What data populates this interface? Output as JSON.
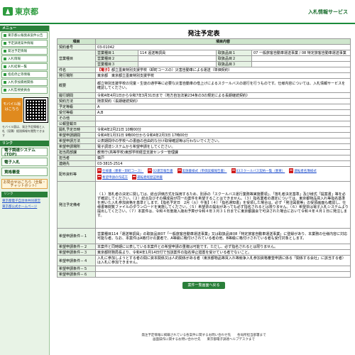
{
  "header": {
    "logo_text": "東京都",
    "site_title": "入札情報サービス"
  },
  "sidebar": {
    "menu_heading": "メニュー",
    "menu_items": [
      "東京都公報発表案件公告",
      "予定調達案件情報",
      "発注予定情報",
      "入札情報",
      "入札結果一覧",
      "指名停止等情報",
      "入札参加資格関係",
      "入札監視委員会"
    ],
    "mobile_label": "モバイル版はこちら",
    "mobile_note": "モバイル版は、発注予定情報と入札（見積）経過情報を閲覧できます",
    "related_heading": "リンク",
    "big_items": [
      "電子調達システム(TOP)",
      "電子入札",
      "資格審査"
    ],
    "faq_label": "お問合せはこちら（全般・チャットボット）",
    "links_heading": "リンク",
    "ext_links": [
      "東京都電子自治体共同運営",
      "東京都公式ホームページ"
    ]
  },
  "main": {
    "page_title": "発注予定表",
    "col_item": "項目",
    "col_content": "項目内容",
    "rows": {
      "contract_no_label": "契約番号",
      "contract_no": "03-01042",
      "category_label": "営業種目",
      "cat1_label": "営業種目１",
      "cat1": "114 遠送等調員",
      "cat2_label": "営業種目２",
      "cat3_label": "営業種目３",
      "handle1_label": "取扱品目１",
      "handle1": "07 一般旅客自動車運送事業 / 08 特定旅客自動車運送事業",
      "handle2_label": "取扱品目２",
      "handle3_label": "取扱品目３",
      "subject_label": "件名",
      "subject_tag": "【電子】",
      "subject": "都立墨東特別支援学校（卸町コースの）災害自動車による運送（単価契約）",
      "agency_label": "発行場所",
      "agency": "東京都　東京都立墨東特別支援学校",
      "overview_label": "概要",
      "overview": "都立特別支援学校の児童・生徒の通学等に必要な災害自動車の借上げによるスクールバスの運行を行うものです。仕様内容については、入札情報サービスを確認してください。",
      "period_label": "履行期間",
      "period": "令和4年4月1日から令和7年3月31日まで（地方自治法第234条の3の規定による長期継続契約）",
      "method_label": "契約方法",
      "method": "随意契約（長期継続契約）",
      "tender_label": "予定等級",
      "tender": "A",
      "grade_label": "受付等級",
      "grade": "A,B",
      "other_label": "その他",
      "notice_date_label": "公報登載日",
      "notice_date": "",
      "open_date_label": "開札予定日時",
      "open_date": "令和4年2月21日 10時00分",
      "apply_period_label": "希望申請期間",
      "apply_period": "令和4年1月31日 9時00分から令和4年2月3日 17時00分",
      "apply_place_label": "希望申請方法",
      "apply_place": "公表期間中の学校への書面の自由的な分け取得確認等は行わないでください。",
      "apply_tel_label": "希望申請場所",
      "apply_tel": "電子調達システムから希望申請をしてください。",
      "dept_label": "担当局部課",
      "dept": "教育庁(高等学校)東部学校経営支援センター管理課",
      "person_label": "担当者",
      "person": "槙戸",
      "contact_label": "連絡先",
      "contact": "03-3815-2514",
      "docs_label": "配布資料等",
      "docs": [
        "仕様書（墨東・卸町コース）",
        "02運営報告書",
        "実施書様式（単価実績報告書）",
        "03スクールバス契約一覧（墨東）",
        "運転者名簿様式",
        "希望申請の作成方",
        "運転者経歴証明書"
      ],
      "terms_label": "発注予定備考",
      "terms": "（１）落札者の決定に関しては、総合評価方式を採用するため、別添の「スクールバス運行業務等実施要領」、「落札者決定基準」及び様式「提案書」等を必ず確認してください。（２）総合及びその構成員が同一の案件を希望することはできません。（３）指名業者の選定については、東京都物品買入れ等指名基準を用いた入札参加資格を基準とします。【指名予定日　2月（火）午後】（４）「指名通知書」を受領した場合は、必ず「発注図書等」の受領画面も確認し、仕様書等閲覧ファイルのダウンロードを実施してください。（５）希望票の提出があっても必ず指名されるとは限りません。（６）希望票は電子入札システムより提出してください。（７）本案件は、令和４年度歳入歳出予算が令和４年３月３１日までに東京都議会で可決された場合において令和４年４月１日に発注します。",
      "cond1_label": "希望申請条件－１",
      "cond1": "営業種目114「運送等調員」の取扱品目07「一般旅客自動車運送事業」又は取扱品目08「特定旅客自動車運送事業」に登録があり、本業務の仕様内容に対応可能な者。なお、本案件はA格付けの業者で、A等級に格付けされている者の他、B等級に格付けされている者も受付対象とします。",
      "cond2_label": "希望申請条件－２",
      "cond2": "本案件と同時期に公表している本案件との希望申請の重複は可能です。ただし、必ず指名されるとは限りません。",
      "cond3_label": "希望申請条件－３",
      "cond3": "東京都財務局長より、令和4年1月14日付で当該案件の指名停止措置を受けている者でないこと。",
      "cond4_label": "希望申請条件－４",
      "cond4": "入札に参加しようとする者の間に資本関係又は人的関係がある者（東京都物品等買入れ等競争入札参加資格審査申請に係る「関係する会社」に該当する者）は入札に参加できません。",
      "cond5_label": "希望申請条件－５",
      "cond6_label": "希望申請条件－６"
    },
    "back_button": "案件一覧画面へ戻る"
  },
  "footer": {
    "line1": "発注予定情報に掲載されている各案件に関するお問い合わせ先　　各局所担当部署まで",
    "line2": "画面操作に関するお問い合わせ先　　東京都電子調達ヘルプデスクまで"
  }
}
